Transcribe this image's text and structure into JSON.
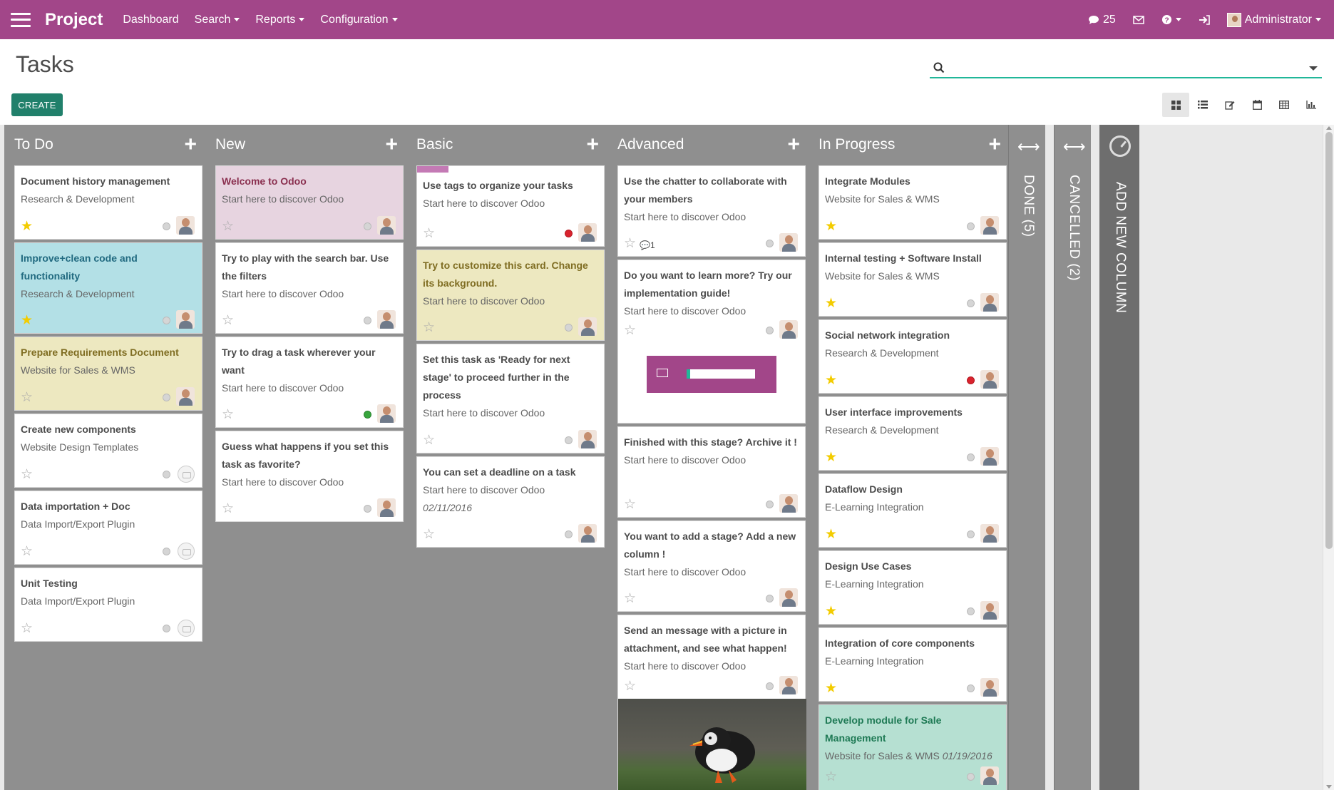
{
  "navbar": {
    "app_title": "Project",
    "menu": [
      {
        "label": "Dashboard",
        "dropdown": false
      },
      {
        "label": "Search",
        "dropdown": true
      },
      {
        "label": "Reports",
        "dropdown": true
      },
      {
        "label": "Configuration",
        "dropdown": true
      }
    ],
    "messages_count": "25",
    "user_name": "Administrator",
    "color": "#a24689"
  },
  "page": {
    "title": "Tasks",
    "search_placeholder": "",
    "create_label": "CREATE"
  },
  "views": [
    "kanban",
    "list",
    "form",
    "calendar",
    "pivot",
    "graph"
  ],
  "columns": [
    {
      "name": "To Do",
      "cards": [
        {
          "title": "Document history management",
          "project": "Research & Development",
          "starred": true,
          "status": "grey",
          "assignee": "face",
          "color": ""
        },
        {
          "title": "Improve+clean code and functionality",
          "project": "Research & Development",
          "starred": true,
          "status": "grey",
          "assignee": "face",
          "color": "#b3e0e6"
        },
        {
          "title": "Prepare Requirements Document",
          "project": "Website for Sales & WMS",
          "starred": false,
          "status": "grey",
          "assignee": "face",
          "color": "#ede8c0"
        },
        {
          "title": "Create new components",
          "project": "Website Design Templates",
          "starred": false,
          "status": "grey",
          "assignee": "none",
          "color": ""
        },
        {
          "title": "Data importation + Doc",
          "project": "Data Import/Export Plugin",
          "starred": false,
          "status": "grey",
          "assignee": "none",
          "color": ""
        },
        {
          "title": "Unit Testing",
          "project": "Data Import/Export Plugin",
          "starred": false,
          "status": "grey",
          "assignee": "none",
          "color": ""
        }
      ]
    },
    {
      "name": "New",
      "cards": [
        {
          "title": "Welcome to Odoo",
          "project": "Start here to discover Odoo",
          "starred": false,
          "status": "grey",
          "assignee": "face",
          "color": "#e7d4e0"
        },
        {
          "title": "Try to play with the search bar. Use the filters",
          "project": "Start here to discover Odoo",
          "starred": false,
          "status": "grey",
          "assignee": "face",
          "color": ""
        },
        {
          "title": "Try to drag a task wherever your want",
          "project": "Start here to discover Odoo",
          "starred": false,
          "status": "green",
          "assignee": "face",
          "color": ""
        },
        {
          "title": "Guess what happens if you set this task as favorite?",
          "project": "Start here to discover Odoo",
          "starred": false,
          "status": "grey",
          "assignee": "face",
          "color": ""
        }
      ]
    },
    {
      "name": "Basic",
      "cards": [
        {
          "title": "Use tags to organize your tasks",
          "project": "Start here to discover Odoo",
          "starred": false,
          "status": "red",
          "assignee": "face",
          "color": "",
          "tag": true
        },
        {
          "title": "Try to customize this card. Change its background.",
          "project": "Start here to discover Odoo",
          "starred": false,
          "status": "grey",
          "assignee": "face",
          "color": "#ede8c0"
        },
        {
          "title": "Set this task as 'Ready for next stage' to proceed further in the process",
          "project": "Start here to discover Odoo",
          "starred": false,
          "status": "grey",
          "assignee": "face",
          "color": ""
        },
        {
          "title": "You can set a deadline on a task",
          "project": "Start here to discover Odoo",
          "deadline": "02/11/2016",
          "starred": false,
          "status": "grey",
          "assignee": "face",
          "color": ""
        }
      ]
    },
    {
      "name": "Advanced",
      "cards": [
        {
          "title": "Use the chatter to collaborate with your members",
          "project": "Start here to discover Odoo",
          "starred": false,
          "status": "grey",
          "assignee": "face",
          "color": "",
          "comments": "1"
        },
        {
          "title": "Do you want to learn more? Try our implementation guide!",
          "project": "Start here to discover Odoo",
          "starred": false,
          "status": "grey",
          "assignee": "face",
          "color": "",
          "email_widget": true
        },
        {
          "title": "Finished with this stage? Archive it !",
          "project": "Start here to discover Odoo",
          "starred": false,
          "status": "grey",
          "assignee": "face",
          "color": ""
        },
        {
          "title": "You want to add a stage? Add a new column !",
          "project": "Start here to discover Odoo",
          "starred": false,
          "status": "grey",
          "assignee": "face",
          "color": ""
        },
        {
          "title": "Send an message with a picture in attachment, and see what happen!",
          "project": "Start here to discover Odoo",
          "starred": false,
          "status": "grey",
          "assignee": "face",
          "color": "",
          "image": true
        }
      ]
    },
    {
      "name": "In Progress",
      "cards": [
        {
          "title": "Integrate Modules",
          "project": "Website for Sales & WMS",
          "starred": true,
          "status": "grey",
          "assignee": "face",
          "color": ""
        },
        {
          "title": "Internal testing + Software Install",
          "project": "Website for Sales & WMS",
          "starred": true,
          "status": "grey",
          "assignee": "face",
          "color": ""
        },
        {
          "title": "Social network integration",
          "project": "Research & Development",
          "starred": true,
          "status": "red",
          "assignee": "face",
          "color": ""
        },
        {
          "title": "User interface improvements",
          "project": "Research & Development",
          "starred": true,
          "status": "grey",
          "assignee": "face",
          "color": ""
        },
        {
          "title": "Dataflow Design",
          "project": "E-Learning Integration",
          "starred": true,
          "status": "grey",
          "assignee": "face",
          "color": ""
        },
        {
          "title": "Design Use Cases",
          "project": "E-Learning Integration",
          "starred": true,
          "status": "grey",
          "assignee": "face",
          "color": ""
        },
        {
          "title": "Integration of core components",
          "project": "E-Learning Integration",
          "starred": true,
          "status": "grey",
          "assignee": "face",
          "color": ""
        },
        {
          "title": "Develop module for Sale Management",
          "project": "Website for Sales & WMS",
          "deadline": "01/19/2016",
          "starred": false,
          "status": "grey",
          "assignee": "face",
          "color": "#b6e0d2"
        }
      ]
    }
  ],
  "folded": [
    {
      "label": "DONE (5)"
    },
    {
      "label": "CANCELLED (2)"
    }
  ],
  "add_column_label": "ADD NEW COLUMN"
}
